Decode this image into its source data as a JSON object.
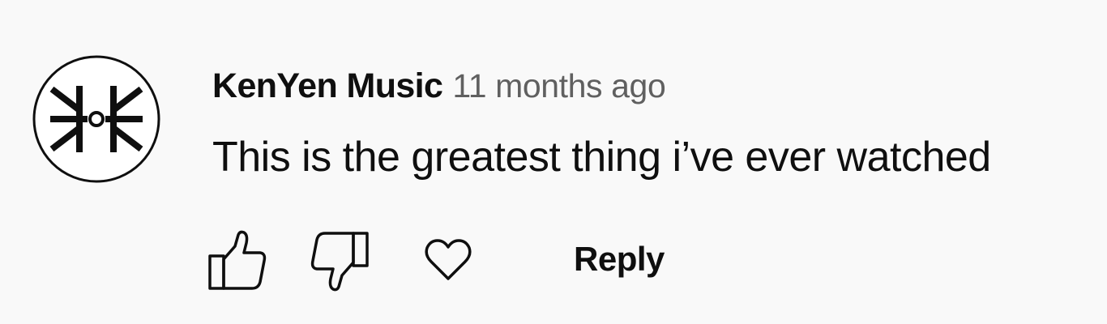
{
  "comment": {
    "author": "KenYen Music",
    "timestamp": "11 months ago",
    "text": "This is the greatest thing i’ve ever watched",
    "avatar_icon": "kenyen-logo-icon",
    "actions": {
      "like_icon": "thumbs-up-icon",
      "dislike_icon": "thumbs-down-icon",
      "heart_icon": "heart-icon",
      "reply_label": "Reply"
    }
  },
  "colors": {
    "background": "#f9f9f9",
    "text_primary": "#0f0f0f",
    "text_secondary": "#606060"
  }
}
